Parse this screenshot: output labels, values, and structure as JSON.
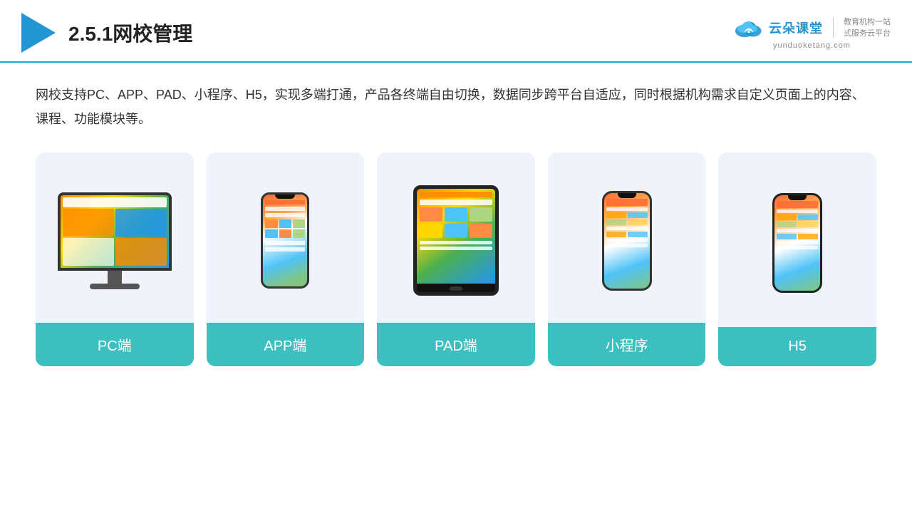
{
  "header": {
    "title": "2.5.1网校管理",
    "title_num": "2.5.1",
    "title_cn": "网校管理"
  },
  "brand": {
    "name": "云朵课堂",
    "url": "yunduoketang.com",
    "slogan_line1": "教育机构一站",
    "slogan_line2": "式服务云平台"
  },
  "description": "网校支持PC、APP、PAD、小程序、H5，实现多端打通，产品各终端自由切换，数据同步跨平台自适应，同时根据机构需求自定义页面上的内容、课程、功能模块等。",
  "cards": [
    {
      "id": "pc",
      "label": "PC端"
    },
    {
      "id": "app",
      "label": "APP端"
    },
    {
      "id": "pad",
      "label": "PAD端"
    },
    {
      "id": "miniprogram",
      "label": "小程序"
    },
    {
      "id": "h5",
      "label": "H5"
    }
  ]
}
